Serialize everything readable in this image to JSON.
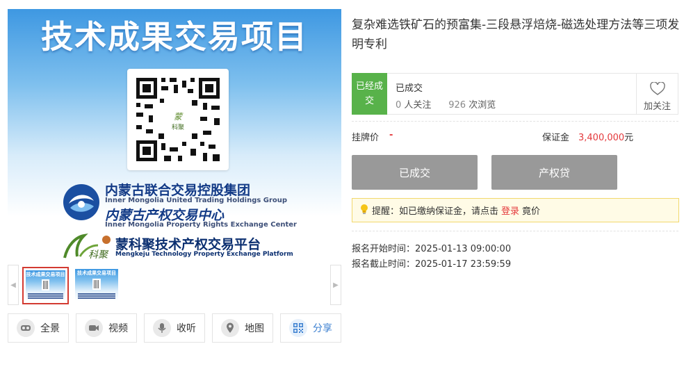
{
  "banner": {
    "title": "技术成果交易项目",
    "org_cn_1": "内蒙古联合交易控股集团",
    "org_en_1": "Inner Mongolia United Trading Holdings Group",
    "org_cn_2": "内蒙古产权交易中心",
    "org_en_2": "Inner Mongolia Property Rights Exchange Center",
    "platform_cn": "蒙科聚技术产权交易平台",
    "platform_en": "Mengkeju Technology Property  Exchange  Platform"
  },
  "thumbnails": {
    "items": [
      {
        "title": "技术成果交易项目",
        "selected": true
      },
      {
        "title": "技术成果交易项目",
        "selected": false
      }
    ],
    "prev_icon": "chevron-left-icon",
    "next_icon": "chevron-right-icon"
  },
  "actions": [
    {
      "label": "全景",
      "icon": "vr-glasses-icon"
    },
    {
      "label": "视频",
      "icon": "video-camera-icon"
    },
    {
      "label": "收听",
      "icon": "microphone-icon"
    },
    {
      "label": "地图",
      "icon": "map-pin-icon"
    },
    {
      "label": "分享",
      "icon": "qr-code-icon"
    }
  ],
  "detail": {
    "title": "复杂难选铁矿石的预富集-三段悬浮焙烧-磁选处理方法等三项发明专利",
    "status_badge": "已经成交",
    "status_text": "已成交",
    "followers_count": "0",
    "followers_label": "人关注",
    "views_count": "926",
    "views_label": "次浏览",
    "follow_label": "加关注",
    "price_label": "挂牌价",
    "price_value": "-",
    "deposit_label": "保证金",
    "deposit_value": "3,400,000",
    "deposit_unit": "元",
    "button_done": "已成交",
    "button_loan": "产权贷",
    "tip_prefix": "提醒：如已缴纳保证金，请点击",
    "tip_link": "登录",
    "tip_suffix": "竟价",
    "start_label": "报名开始时间：",
    "start_time": "2025-01-13 09:00:00",
    "end_label": "报名截止时间：",
    "end_time": "2025-01-17 23:59:59"
  },
  "colors": {
    "badge_green": "#58b24a",
    "price_red": "#e4393c",
    "button_gray": "#999999",
    "share_blue": "#3b7fd0"
  }
}
